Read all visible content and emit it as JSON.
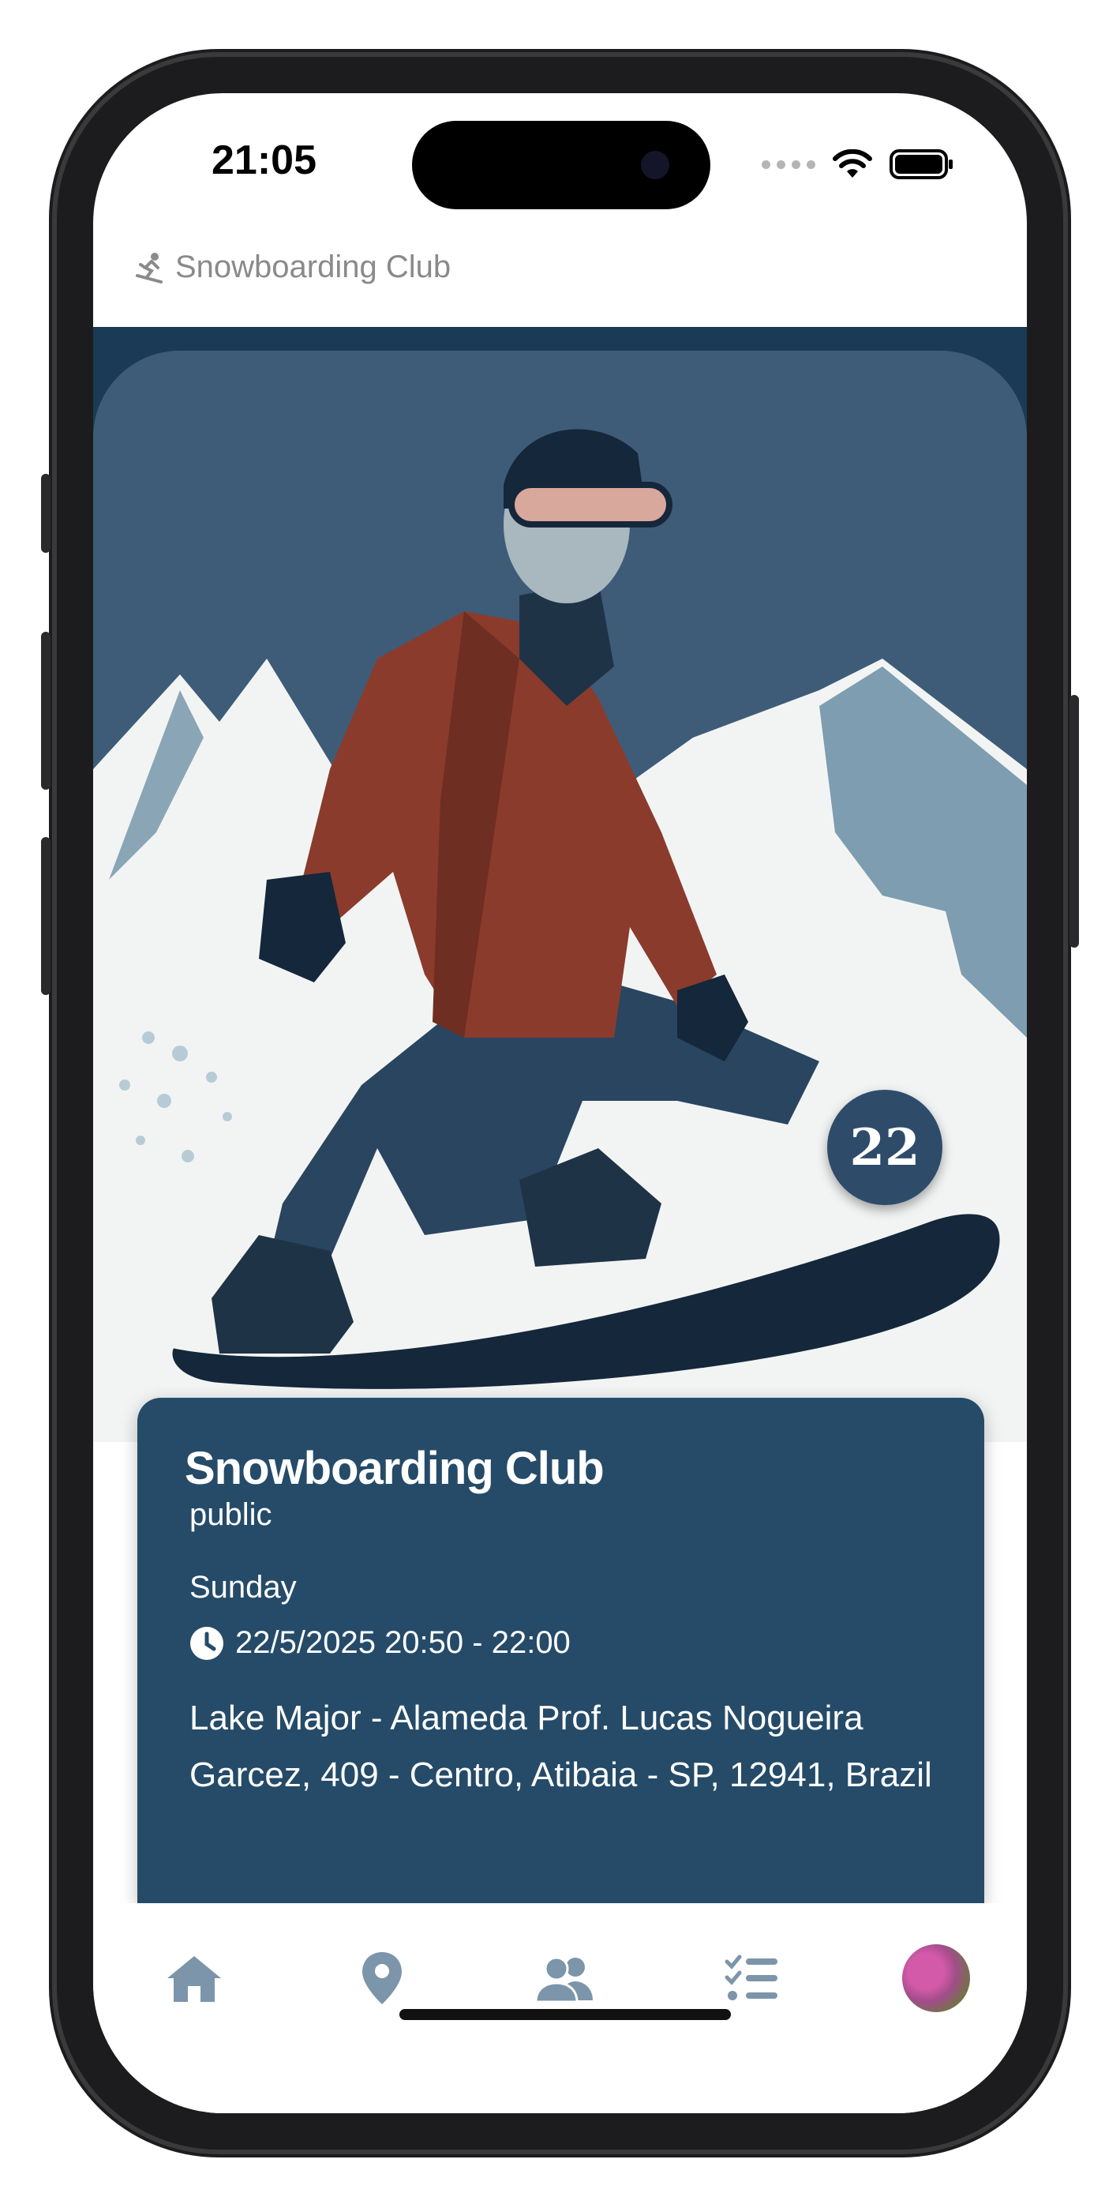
{
  "status_bar": {
    "time": "21:05"
  },
  "header": {
    "icon": "snowboarder-icon",
    "title": "Snowboarding Club"
  },
  "hero": {
    "badge_number": "22"
  },
  "event": {
    "name": "Snowboarding Club",
    "visibility": "public",
    "day": "Sunday",
    "datetime": "22/5/2025 20:50 - 22:00",
    "address": "Lake Major - Alameda Prof. Lucas Nogueira Garcez, 409 - Centro, Atibaia - SP, 12941, Brazil"
  },
  "tabbar": {
    "items": [
      {
        "icon": "home-icon"
      },
      {
        "icon": "location-pin-icon"
      },
      {
        "icon": "people-icon"
      },
      {
        "icon": "checklist-icon"
      },
      {
        "icon": "avatar"
      }
    ]
  },
  "colors": {
    "card_background": "#254b68",
    "tab_icon": "#7c95aa",
    "header_text": "#8a8a8a",
    "badge": "#2e4c6a"
  }
}
